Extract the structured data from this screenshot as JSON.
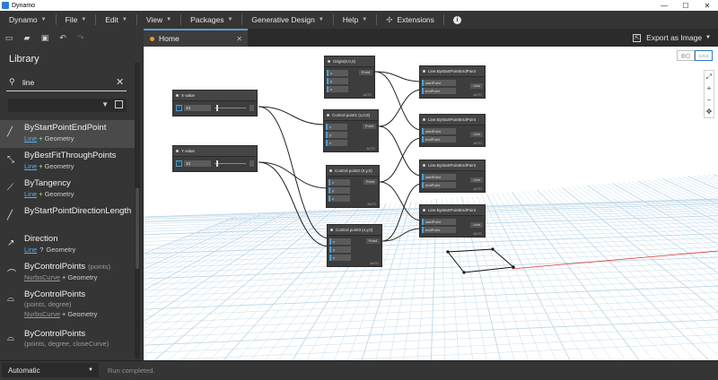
{
  "window": {
    "title": "Dynamo"
  },
  "menubar": {
    "items": [
      "Dynamo",
      "File",
      "Edit",
      "View",
      "Packages",
      "Generative Design",
      "Help"
    ],
    "extensions_label": "Extensions"
  },
  "tabs": {
    "home_label": "Home"
  },
  "export": {
    "label": "Export as Image"
  },
  "library": {
    "title": "Library",
    "search_value": "line",
    "entries": [
      {
        "name": "ByStartPointEndPoint",
        "params": "",
        "line2": "",
        "type": "Line",
        "return": "Geometry",
        "link_style": "plus",
        "icon": "line-icon"
      },
      {
        "name": "ByBestFitThroughPoints",
        "params": "",
        "line2": "",
        "type": "Line",
        "return": "Geometry",
        "link_style": "plus",
        "icon": "fit-line-icon"
      },
      {
        "name": "ByTangency",
        "params": "",
        "line2": "",
        "type": "Line",
        "return": "Geometry",
        "link_style": "plus",
        "icon": "tangent-line-icon"
      },
      {
        "name": "ByStartPointDirectionLength",
        "params": "",
        "line2": "",
        "type": "",
        "return": "",
        "link_style": "none",
        "icon": "direction-line-icon"
      },
      {
        "name": "Direction",
        "params": "",
        "line2": "",
        "type": "Line",
        "return": "Geometry",
        "link_style": "query",
        "icon": "direction-icon"
      },
      {
        "name": "ByControlPoints",
        "params": "(points)",
        "line2": "",
        "type": "NurbsCurve",
        "return": "Geometry",
        "link_style": "plus",
        "icon": "curve-icon"
      },
      {
        "name": "ByControlPoints",
        "params": "",
        "line2": "(points, degree)",
        "type": "NurbsCurve",
        "return": "Geometry",
        "link_style": "plus",
        "icon": "curve-degree-icon"
      },
      {
        "name": "ByControlPoints",
        "params": "",
        "line2": "(points, degree, closeCurve)",
        "type": "",
        "return": "",
        "link_style": "none",
        "icon": "curve-closed-icon"
      }
    ]
  },
  "canvas": {
    "slider_nodes": [
      {
        "name": "X value",
        "value": "10"
      },
      {
        "name": "Y value",
        "value": "10"
      }
    ],
    "point_nodes": [
      {
        "name": "Origin(0,0,0)",
        "inputs": [
          "x",
          "y",
          "z"
        ],
        "output": "Point"
      },
      {
        "name": "Control point1 (x,0,0)",
        "inputs": [
          "x",
          "y",
          "z"
        ],
        "output": "Point"
      },
      {
        "name": "Control point2 (0,y,0)",
        "inputs": [
          "x",
          "y",
          "z"
        ],
        "output": "Point"
      },
      {
        "name": "Control point3 (x,y,0)",
        "inputs": [
          "x",
          "y",
          "z"
        ],
        "output": "Point"
      }
    ],
    "line_nodes": [
      {
        "name": "Line.ByStartPointEndPoint",
        "inputs": [
          "startPoint",
          "endPoint"
        ],
        "output": "Line"
      },
      {
        "name": "Line.ByStartPointEndPoint",
        "inputs": [
          "startPoint",
          "endPoint"
        ],
        "output": "Line"
      },
      {
        "name": "Line.ByStartPointEndPoint",
        "inputs": [
          "startPoint",
          "endPoint"
        ],
        "output": "Line"
      },
      {
        "name": "Line.ByStartPointEndPoint",
        "inputs": [
          "startPoint",
          "endPoint"
        ],
        "output": "Line"
      }
    ],
    "lacing_label": "AUTO"
  },
  "statusbar": {
    "run_mode": "Automatic",
    "status_text": "Run completed."
  },
  "colors": {
    "accent": "#49a1dc",
    "tab_dot": "#e59a2e",
    "axis_x": "#e03030",
    "grid": "#b8d4e6"
  }
}
